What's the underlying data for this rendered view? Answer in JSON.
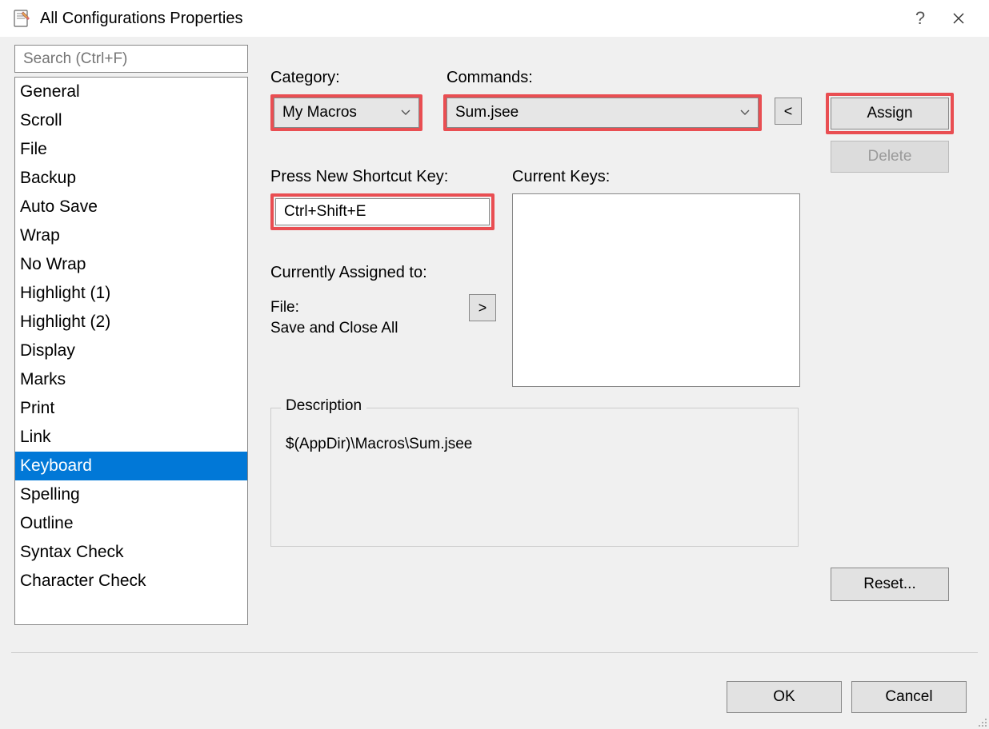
{
  "window": {
    "title": "All Configurations Properties"
  },
  "search": {
    "placeholder": "Search (Ctrl+F)"
  },
  "sidebar": {
    "items": [
      "General",
      "Scroll",
      "File",
      "Backup",
      "Auto Save",
      "Wrap",
      "No Wrap",
      "Highlight (1)",
      "Highlight (2)",
      "Display",
      "Marks",
      "Print",
      "Link",
      "Keyboard",
      "Spelling",
      "Outline",
      "Syntax Check",
      "Character Check"
    ],
    "selected": "Keyboard"
  },
  "labels": {
    "category": "Category:",
    "commands": "Commands:",
    "press_new": "Press New Shortcut Key:",
    "current_keys": "Current Keys:",
    "currently_assigned": "Currently Assigned to:",
    "description": "Description"
  },
  "values": {
    "category": "My Macros",
    "command": "Sum.jsee",
    "new_shortcut": "Ctrl+Shift+E",
    "assigned_line1": "File:",
    "assigned_line2": "Save and Close All",
    "description_path": "$(AppDir)\\Macros\\Sum.jsee"
  },
  "buttons": {
    "less": "<",
    "greater": ">",
    "assign": "Assign",
    "delete": "Delete",
    "reset": "Reset...",
    "ok": "OK",
    "cancel": "Cancel",
    "help": "?",
    "close": "✕"
  }
}
